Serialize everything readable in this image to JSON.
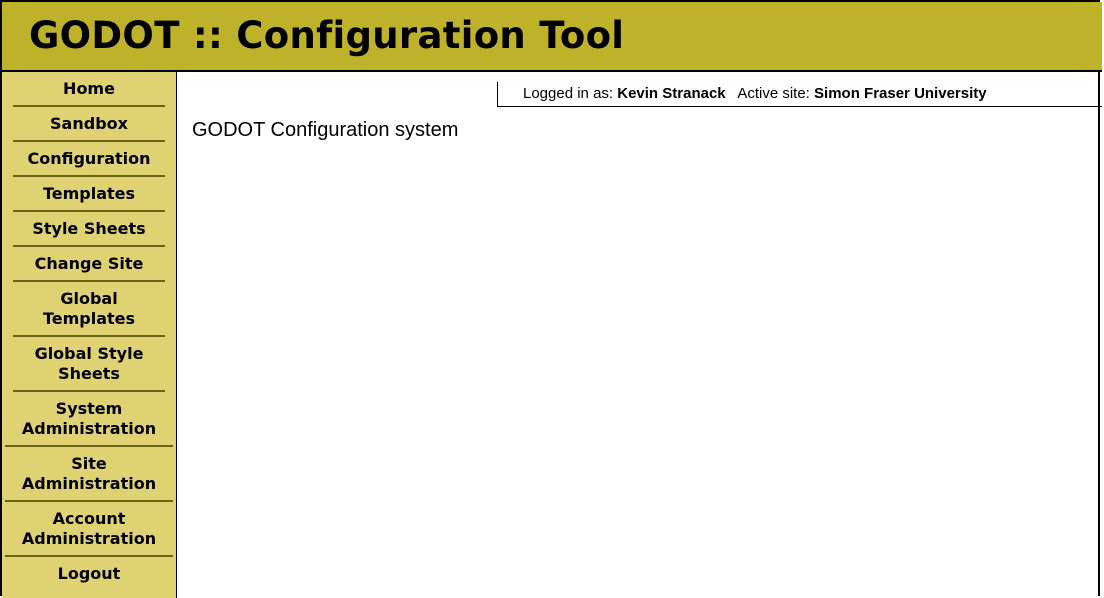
{
  "header": {
    "title": "GODOT :: Configuration Tool"
  },
  "sidebar": {
    "items": [
      {
        "label": "Home"
      },
      {
        "label": "Sandbox"
      },
      {
        "label": "Configuration"
      },
      {
        "label": "Templates"
      },
      {
        "label": "Style Sheets"
      },
      {
        "label": "Change Site"
      },
      {
        "label_line1": "Global",
        "label_line2": "Templates"
      },
      {
        "label_line1": "Global Style",
        "label_line2": "Sheets"
      },
      {
        "label_line1": "System",
        "label_line2": "Administration"
      },
      {
        "label_line1": "Site",
        "label_line2": "Administration"
      },
      {
        "label_line1": "Account",
        "label_line2": "Administration"
      },
      {
        "label": "Logout"
      }
    ]
  },
  "status": {
    "logged_in_label": "Logged in as:",
    "user_name": "Kevin Stranack",
    "active_site_label": "Active site:",
    "site_name": "Simon Fraser University"
  },
  "main": {
    "text": "GODOT Configuration system"
  },
  "colors": {
    "header_bg": "#bfb22b",
    "sidebar_bg": "#dfd273",
    "divider": "#6b6414"
  }
}
